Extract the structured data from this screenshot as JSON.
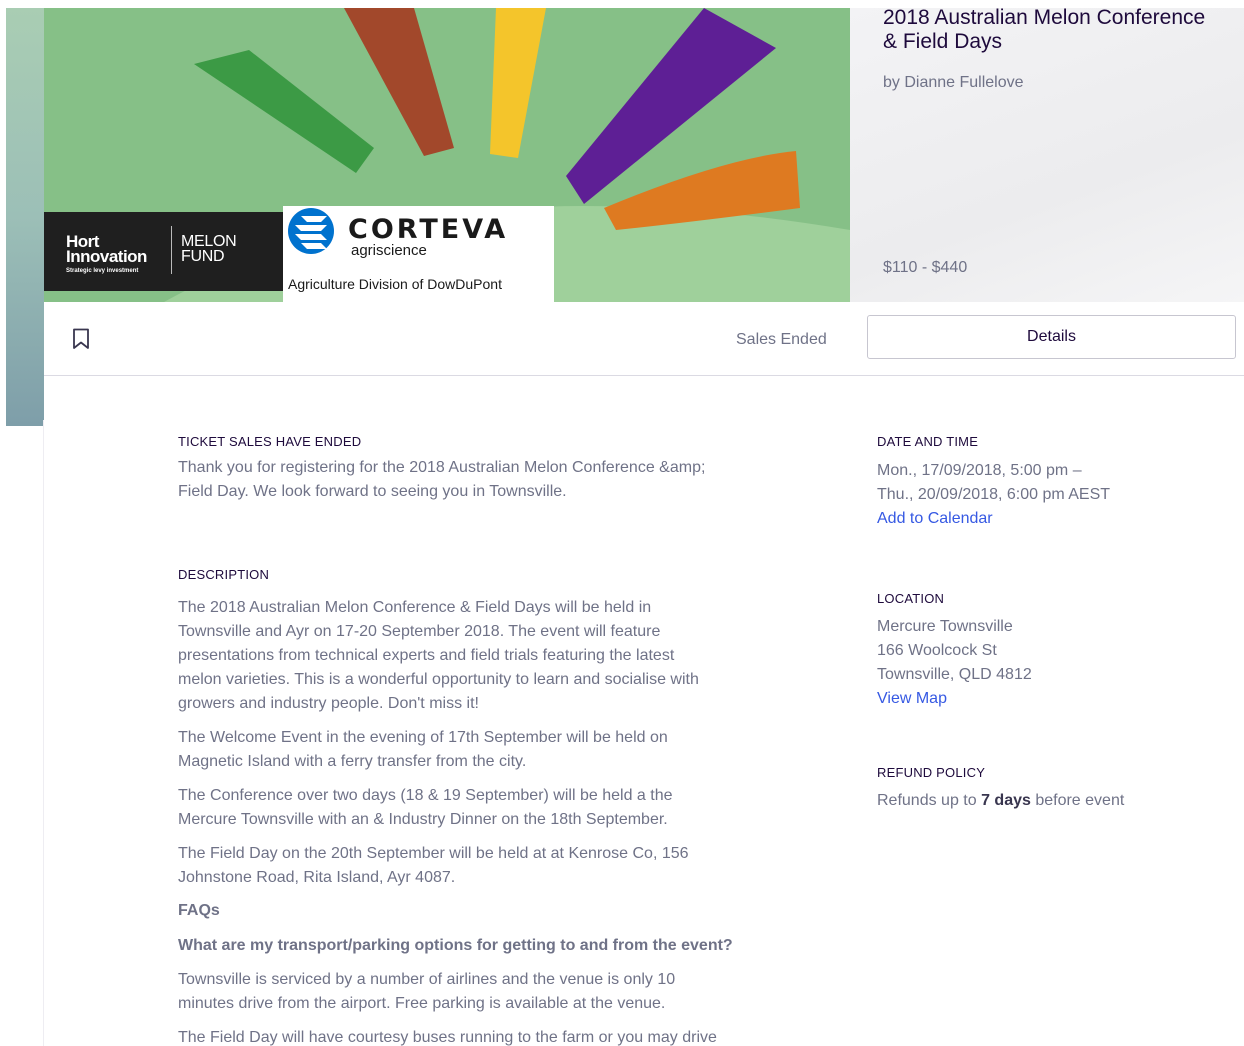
{
  "hero": {
    "logos": {
      "hort_line1": "Hort",
      "hort_line2": "Innovation",
      "hort_tagline": "Strategic levy investment",
      "melon_line1": "MELON",
      "melon_line2": "FUND",
      "corteva": "CORTEVA",
      "corteva_sub": "agriscience",
      "division": "Agriculture Division of DowDuPont"
    },
    "colors": {
      "background": "#86c087",
      "light_green": "#9fd09b",
      "green": "#3c9a45",
      "brown": "#a2482b",
      "yellow": "#f4c52b",
      "purple": "#5e1f95",
      "orange": "#de7a21"
    }
  },
  "panel": {
    "title": "2018 Australian Melon Conference & Field Days",
    "organizer": "by Dianne Fullelove",
    "price": "$110 - $440"
  },
  "bar": {
    "bookmark_icon": "bookmark-icon",
    "sales_status": "Sales Ended",
    "details_label": "Details"
  },
  "main": {
    "ticket_heading": "TICKET SALES HAVE ENDED",
    "ticket_lines": [
      "Thank you for registering for the 2018 Australian Melon Conference &amp;",
      "Field Day. We look forward to seeing you in Townsville."
    ],
    "description_heading": "DESCRIPTION",
    "description_lines": [
      "The 2018 Australian Melon Conference & Field Days will be held in",
      "Townsville and Ayr on 17-20 September 2018. The event will feature",
      "presentations from technical experts and field trials featuring the latest",
      "melon varieties. This is a wonderful opportunity to learn and socialise with",
      "growers and industry people. Don't miss it!"
    ],
    "welcome_lines": [
      "The Welcome Event in the evening of 17th September will be held on",
      "Magnetic Island with a ferry transfer from the city."
    ],
    "conference_lines": [
      "The Conference over two days (18 & 19 September) will be held a the",
      "Mercure Townsville with an & Industry Dinner on the 18th September."
    ],
    "fieldday_lines": [
      "The Field Day on the 20th September will be held at at Kenrose Co, 156",
      "Johnstone Road, Rita Island, Ayr 4087."
    ],
    "faqs_heading": "FAQs",
    "faq_question": "What are my transport/parking options for getting to and from the event?",
    "faq_answer_lines": [
      "Townsville is serviced by a number of airlines and the venue is only 10",
      "minutes drive from the airport. Free parking is available at the venue."
    ],
    "cut_line": "The Field Day will have courtesy buses running to the farm or you may drive"
  },
  "side": {
    "date_heading": "DATE AND TIME",
    "date_line1": "Mon., 17/09/2018, 5:00 pm –",
    "date_line2": "Thu., 20/09/2018, 6:00 pm AEST",
    "add_calendar": "Add to Calendar",
    "location_heading": "LOCATION",
    "venue": "Mercure Townsville",
    "street": "166 Woolcock St",
    "city": "Townsville, QLD 4812",
    "view_map": "View Map",
    "refund_heading": "REFUND POLICY",
    "refund_prefix": "Refunds up to ",
    "refund_days": "7 days",
    "refund_suffix": " before event"
  }
}
